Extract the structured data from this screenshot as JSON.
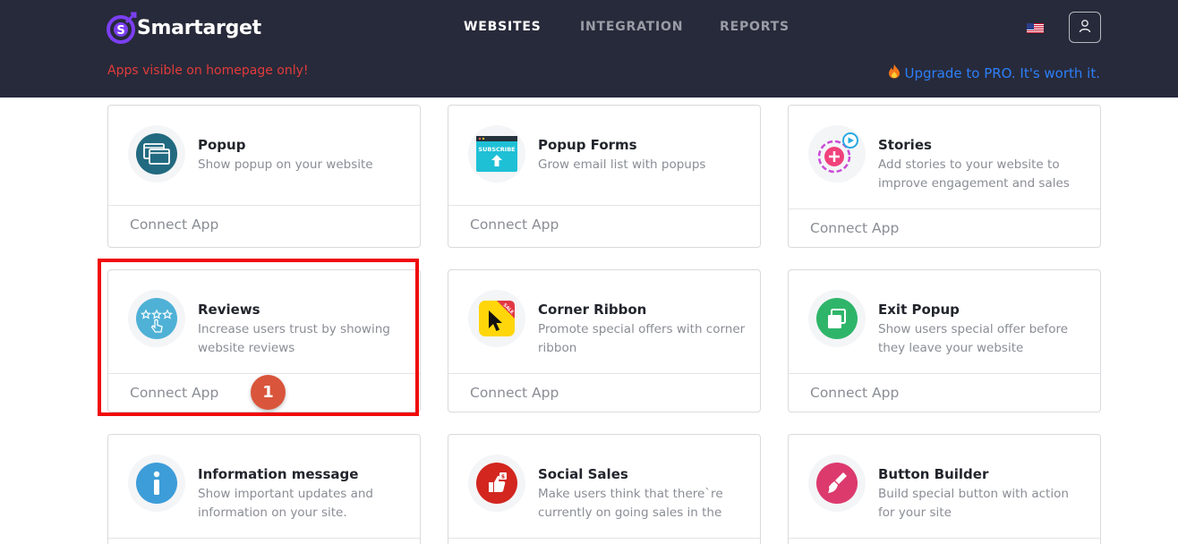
{
  "header": {
    "brand": "Smartarget",
    "nav": [
      {
        "label": "WEBSITES",
        "active": true
      },
      {
        "label": "INTEGRATION",
        "active": false
      },
      {
        "label": "REPORTS",
        "active": false
      }
    ],
    "notice": "Apps visible on homepage only!",
    "upgrade": "Upgrade to PRO. It's worth it.",
    "upgrade_icon": "fire-icon",
    "colors": {
      "bg": "#272a3a",
      "notice": "#e23b3b",
      "link": "#2d7ff9"
    }
  },
  "cards": [
    {
      "title": "Popup",
      "desc": "Show popup on your website",
      "connect": "Connect App",
      "icon": "popup-windows-icon"
    },
    {
      "title": "Popup Forms",
      "desc": "Grow email list with popups",
      "connect": "Connect App",
      "icon": "subscribe-form-icon",
      "icon_text": "SUBSCRIBE"
    },
    {
      "title": "Stories",
      "desc": "Add stories to your website to improve engagement and sales",
      "connect": "Connect App",
      "icon": "stories-icon"
    },
    {
      "title": "Reviews",
      "desc": "Increase users trust by showing website reviews",
      "connect": "Connect App",
      "icon": "reviews-stars-icon"
    },
    {
      "title": "Corner Ribbon",
      "desc": "Promote special offers with corner ribbon",
      "connect": "Connect App",
      "icon": "corner-ribbon-icon",
      "icon_text": "SALE"
    },
    {
      "title": "Exit Popup",
      "desc": "Show users special offer before they leave your website",
      "connect": "Connect App",
      "icon": "exit-popup-icon"
    },
    {
      "title": "Information message",
      "desc": "Show important updates and information on your site.",
      "connect": "",
      "icon": "info-icon"
    },
    {
      "title": "Social Sales",
      "desc": "Make users think that there`re currently on going sales in the",
      "connect": "",
      "icon": "social-sales-icon"
    },
    {
      "title": "Button Builder",
      "desc": "Build special button with action for your site",
      "connect": "",
      "icon": "button-builder-icon"
    }
  ],
  "annotation": {
    "step": "1",
    "color": "#f00a0a"
  }
}
